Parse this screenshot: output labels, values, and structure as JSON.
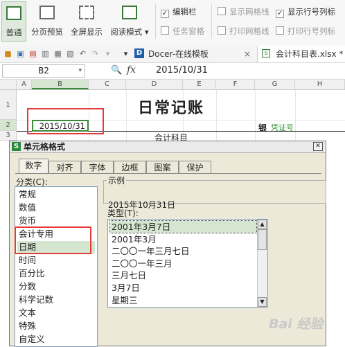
{
  "ribbon": {
    "buttons": [
      "普通",
      "分页预览",
      "全屏显示",
      "阅读模式 ▾"
    ],
    "checks_col1": [
      {
        "label": "编辑栏",
        "checked": true
      },
      {
        "label": "任务窗格",
        "checked": false
      }
    ],
    "checks_col2": [
      {
        "label": "显示网格线",
        "checked": false
      },
      {
        "label": "打印网格线",
        "checked": false
      }
    ],
    "checks_col3": [
      {
        "label": "显示行号列标",
        "checked": true
      },
      {
        "label": "打印行号列标",
        "checked": false
      }
    ]
  },
  "toolbar": {
    "tab1": "Docer-在线模板",
    "tab2": "会计科目表.xlsx *",
    "close_glyph": "×"
  },
  "formula": {
    "cell_ref": "B2",
    "fx": "fx",
    "value": "2015/10/31"
  },
  "sheet": {
    "columns": [
      "A",
      "B",
      "C",
      "D",
      "E",
      "F",
      "G",
      "H"
    ],
    "rows": [
      "1",
      "2",
      "3"
    ],
    "title": "日常记账",
    "date_cell": "2015/10/31",
    "account_header": "会计科目",
    "voucher_prefix": "银",
    "voucher_label": "凭证号"
  },
  "dialog": {
    "title": "单元格格式",
    "tabs": [
      "数字",
      "对齐",
      "字体",
      "边框",
      "图案",
      "保护"
    ],
    "category_label": "分类(C):",
    "categories": [
      "常规",
      "数值",
      "货币",
      "会计专用",
      "日期",
      "时间",
      "百分比",
      "分数",
      "科学记数",
      "文本",
      "特殊",
      "自定义"
    ],
    "selected_category": "日期",
    "sample_label": "示例",
    "sample_value": "2015年10月31日",
    "type_label": "类型(T):",
    "types": [
      "2001年3月7日",
      "2001年3月",
      "二〇〇一年三月七日",
      "二〇〇一年三月",
      "三月七日",
      "3月7日",
      "星期三"
    ],
    "selected_type": "2001年3月7日",
    "close_glyph": "✕"
  },
  "watermark": "Bai 经验",
  "accent_red": "#e53a3a"
}
